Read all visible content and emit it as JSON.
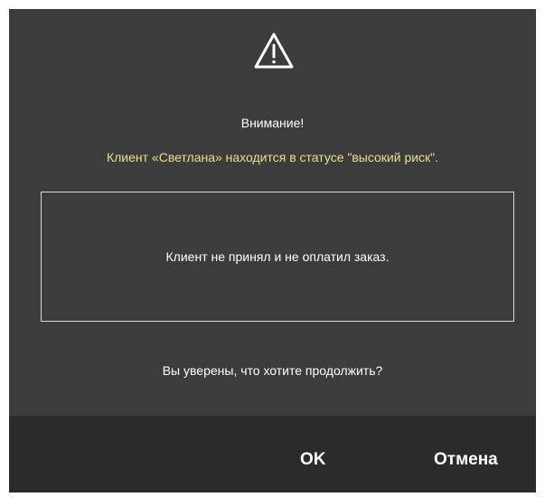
{
  "dialog": {
    "icon": "warning-triangle-icon",
    "title": "Внимание!",
    "subtitle": "Клиент «Светлана» находится в статусе \"высокий риск\".",
    "subtitle_color": "#e6e08a",
    "message": "Клиент не принял и не оплатил заказ.",
    "question": "Вы уверены, что хотите продолжить?",
    "ok_label": "OK",
    "cancel_label": "Отмена",
    "background_color": "#3c3c3c",
    "footer_color": "#2b2b2b"
  }
}
